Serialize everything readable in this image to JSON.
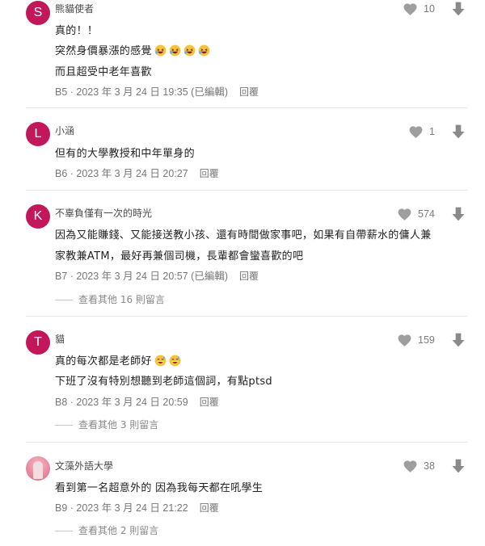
{
  "colors": {
    "avatar_s": "#c2185b",
    "avatar_l": "#c2185b",
    "avatar_k": "#c2185b",
    "avatar_t": "#c2185b",
    "icon_gray": "#9e9e9e"
  },
  "comments": [
    {
      "avatar_letter": "S",
      "author": "熊貓使者",
      "lines": [
        "真的！！",
        "突然身價暴漲的感覺",
        "而且超受中老年喜歡"
      ],
      "emojis": [
        "rofl-emoji",
        "rofl-emoji",
        "rofl-emoji",
        "rofl-emoji"
      ],
      "meta": "B5 · 2023 年 3 月 24 日 19:35 (已編輯)",
      "reply_label": "回覆",
      "likes": "10"
    },
    {
      "avatar_letter": "L",
      "author": "小涵",
      "lines": [
        "但有的大學教授和中年單身的"
      ],
      "meta": "B6 · 2023 年 3 月 24 日 20:27",
      "reply_label": "回覆",
      "likes": "1"
    },
    {
      "avatar_letter": "K",
      "author": "不辜負僅有一次的時光",
      "lines": [
        "因為又能賺錢、又能接送教小孩、還有時間做家事吧，如果有自帶薪水的傭人兼",
        "家教兼ATM，最好再兼個司機，長輩都會蠻喜歡的吧"
      ],
      "meta": "B7 · 2023 年 3 月 24 日 20:57 (已編輯)",
      "reply_label": "回覆",
      "likes": "574",
      "more_replies": "查看其他 16 則留言"
    },
    {
      "avatar_letter": "T",
      "author": "貓",
      "lines": [
        "真的每次都是老師好",
        "下班了沒有特別想聽到老師這個詞，有點ptsd"
      ],
      "emojis": [
        "sweat-smile-emoji",
        "sweat-smile-emoji"
      ],
      "meta": "B8 · 2023 年 3 月 24 日 20:59",
      "reply_label": "回覆",
      "likes": "159",
      "more_replies": "查看其他 3 則留言"
    },
    {
      "avatar_letter": "",
      "author": "文藻外語大學",
      "lines": [
        "看到第一名超意外的 因為我每天都在吼學生"
      ],
      "meta": "B9 · 2023 年 3 月 24 日 21:22",
      "reply_label": "回覆",
      "likes": "38",
      "more_replies": "查看其他 2 則留言"
    }
  ]
}
